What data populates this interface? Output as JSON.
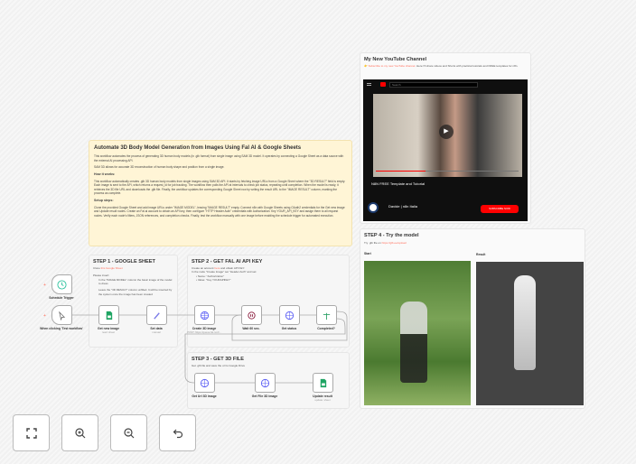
{
  "sticky_main": {
    "title": "Automate 3D Body Model Generation from Images Using Fal AI & Google Sheets",
    "intro": "This workflow automates the process of generating 3D human body models (in .glb format) from single image using SAM 3D model. It operates by connecting a Google Sheet as a data source with the external AI processing API.",
    "intro2": "SAM 3D allows for accurate 3D reconstruction of human body shape and position from a single image.",
    "how_title": "How it works:",
    "how_text": "This workflow automatically creates .glb 3D human body models from single images using SAM 3D API. It starts by fetching image URLs from a Google Sheet where the \"3D RESULT\" field is empty. Each image is sent to the API, which returns a request_id for job tracking. The workflow then polls the API at intervals to check job status, repeating until completion. When the model is ready, it retrieves the 3D file URL and downloads the .glb file. Finally, the workflow updates the corresponding Google Sheet row by writing the result URL to the \"IMAGE RESULT\" column, marking the process as complete.",
    "setup_title": "Setup steps:",
    "setup_text": "Clone the provided Google Sheet and add image URLs under \"IMAGE MODEL\", leaving \"IMAGE RESULT\" empty. Connect n8n with Google Sheets using OAuth2 credentials for the Get new image and Update result nodes. Create an Fal.ai account to obtain an API key, then configure \"HTTP Header Auth\" credentials with Authorization: Key YOUR_API_KEY and assign them to all request nodes. Verify each node's filters, JSON references, and completion checks. Finally, test the workflow manually with one image before enabling the schedule trigger for automated execution."
  },
  "step1": {
    "title": "STEP 1 - GOOGLE SHEET",
    "clone_prefix": "Clone ",
    "clone_link": "this Google Sheet",
    "please": "Please insert:",
    "bullet": "In the \"IMAGE MODEL\" column the basic image of the model to dress",
    "note": "Leave the \"3D RESULT\" column unfilled. It will be inserted by the system once the image has been created"
  },
  "step2": {
    "title": "STEP 2 - GET FAL AI API KEY",
    "line1_prefix": "Create an account ",
    "line1_link": "here",
    "line1_suffix": " and obtain API KEY.",
    "line2": "In the node \"Create Image\" set \"Header Auth\" and set:",
    "b1": "Name: \"Authorization\"",
    "b2": "Value: \"Key YOURAPIKEY\""
  },
  "step3": {
    "title": "STEP 3 - GET 3D FILE",
    "text": "Get .glb file and save the url to Google Drive"
  },
  "youtube": {
    "title": "My New YouTube Channel",
    "sub_link": "👉 Subscribe to my new YouTube channel",
    "sub_text": ". Here I'll share videos and Shorts with practical tutorials and FREE templates for n8n.",
    "search": "Search",
    "video_title": "N8N FREE Template and Tutorial",
    "channel": "Davide | n8n Italia",
    "subscribe": "SUBSCRIBE NOW"
  },
  "step4": {
    "title": "STEP 4 - Try the model",
    "try_prefix": "Try .glb file on ",
    "try_link": "https://glb.ee/upload",
    "start": "Start",
    "result": "Result"
  },
  "nodes": {
    "schedule": {
      "label": "Schedule Trigger"
    },
    "manual": {
      "label": "When clicking 'Test workflow'"
    },
    "get_new_image": {
      "label": "Get new image",
      "sub": "read: sheet"
    },
    "set_data": {
      "label": "Set data",
      "sub": "manual"
    },
    "create_3d": {
      "label": "Create 3D image",
      "sub": "POST: https://queue.fal.run/f..."
    },
    "wait": {
      "label": "Wait 60 sec."
    },
    "get_status": {
      "label": "Get status"
    },
    "completed": {
      "label": "Completed?"
    },
    "get_url": {
      "label": "Get Url 3D image"
    },
    "get_file": {
      "label": "Get File 3D image"
    },
    "update": {
      "label": "Update result",
      "sub": "update: sheet"
    }
  },
  "colors": {
    "accent": "#ff6d5a",
    "sheets": "#1fa463",
    "http": "#5b5ef4"
  }
}
